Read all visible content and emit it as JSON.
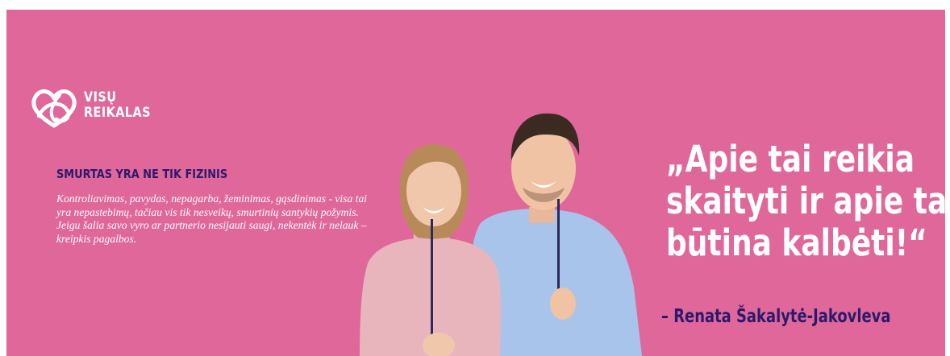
{
  "brand": {
    "logo_line1": "VISŲ",
    "logo_line2": "REIKALAS",
    "icon": "heart-knot-icon"
  },
  "left": {
    "headline": "SMURTAS YRA NE TIK FIZINIS",
    "body": "Kontroliavimas, pavydas, nepagarba, žeminimas, gąsdinimas - visa tai yra nepastebimų, tačiau vis tik nesveikų, smurtinių santykių požymis. Jeigu šalia savo vyro ar partnerio nesijauti saugi, nekentėk ir nelauk – kreipkis pagalbos."
  },
  "quote": {
    "line1": "„Apie tai reikia",
    "line2": "skaityti ir apie tai",
    "line3": "būtina kalbėti!“",
    "author": "– Renata Šakalytė-Jakovleva"
  },
  "colors": {
    "background": "#e0679a",
    "accent_text": "#2b1a6b",
    "text": "#ffffff"
  }
}
